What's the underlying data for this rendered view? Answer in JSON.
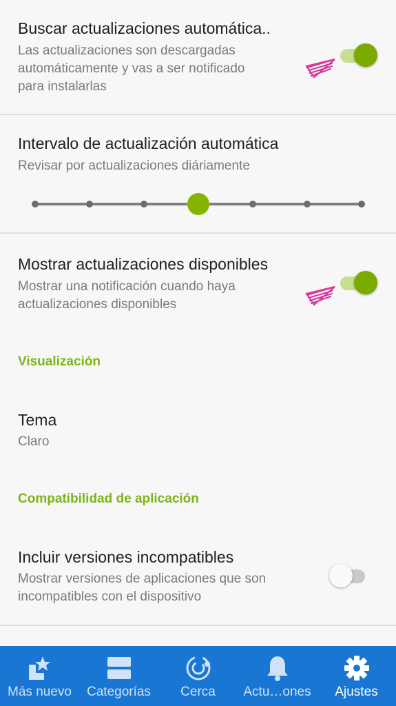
{
  "prefs": {
    "auto_updates": {
      "title": "Buscar actualizaciones automática..",
      "subtitle_lines": [
        "Las actualizaciones son descargadas",
        "automáticamente y vas a ser notificado",
        "para instalarlas"
      ],
      "enabled": true
    },
    "update_interval": {
      "title": "Intervalo de actualización automática",
      "subtitle": "Revisar por actualizaciones diáriamente",
      "slider_steps": 7,
      "slider_selected_index": 3
    },
    "show_updates": {
      "title": "Mostrar actualizaciones disponibles",
      "subtitle_lines": [
        "Mostrar una notificación cuando haya",
        "actualizaciones disponibles"
      ],
      "enabled": true
    },
    "display_section": "Visualización",
    "theme": {
      "title": "Tema",
      "subtitle": "Claro"
    },
    "compat_section": "Compatibilidad de aplicación",
    "incompatible_versions": {
      "title": "Incluir versiones incompatibles",
      "subtitle_lines": [
        "Mostrar versiones de aplicaciones que son",
        "incompatibles con el dispositivo"
      ],
      "enabled": false
    }
  },
  "colors": {
    "accent": "#7cab00",
    "section_header": "#7cb518",
    "nav_bar": "#1976d2",
    "annotation_arrow": "#d63a9a"
  },
  "bottom_nav": {
    "items": [
      {
        "label": "Más nuevo",
        "icon": "star-badge-icon"
      },
      {
        "label": "Categorías",
        "icon": "categories-icon"
      },
      {
        "label": "Cerca",
        "icon": "nearby-icon"
      },
      {
        "label": "Actu…ones",
        "icon": "bell-icon"
      },
      {
        "label": "Ajustes",
        "icon": "gear-icon",
        "active": true
      }
    ]
  }
}
